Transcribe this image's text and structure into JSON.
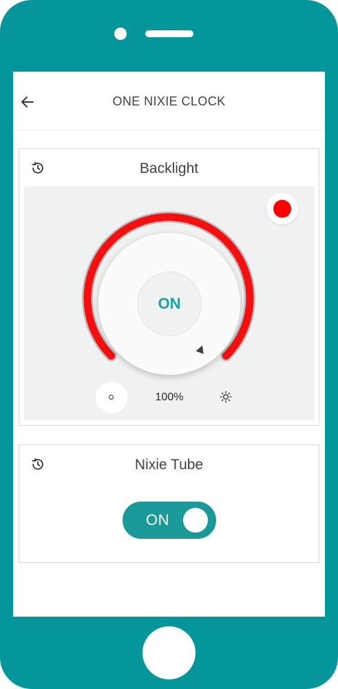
{
  "header": {
    "title": "ONE NIXIE CLOCK",
    "back_icon": "arrow-left-icon"
  },
  "backlight": {
    "title": "Backlight",
    "history_icon": "history-icon",
    "power_label": "ON",
    "brightness": "100%",
    "brightness_fraction": 1.0,
    "color": "#ff0000",
    "arc_color": "#f70f0f"
  },
  "nixie_tube": {
    "title": "Nixie Tube",
    "history_icon": "history-icon",
    "switch_label": "ON",
    "switch_on": true
  },
  "colors": {
    "accent": "#03979c",
    "toggle": "#199a98",
    "on_text": "#1aa39c"
  }
}
